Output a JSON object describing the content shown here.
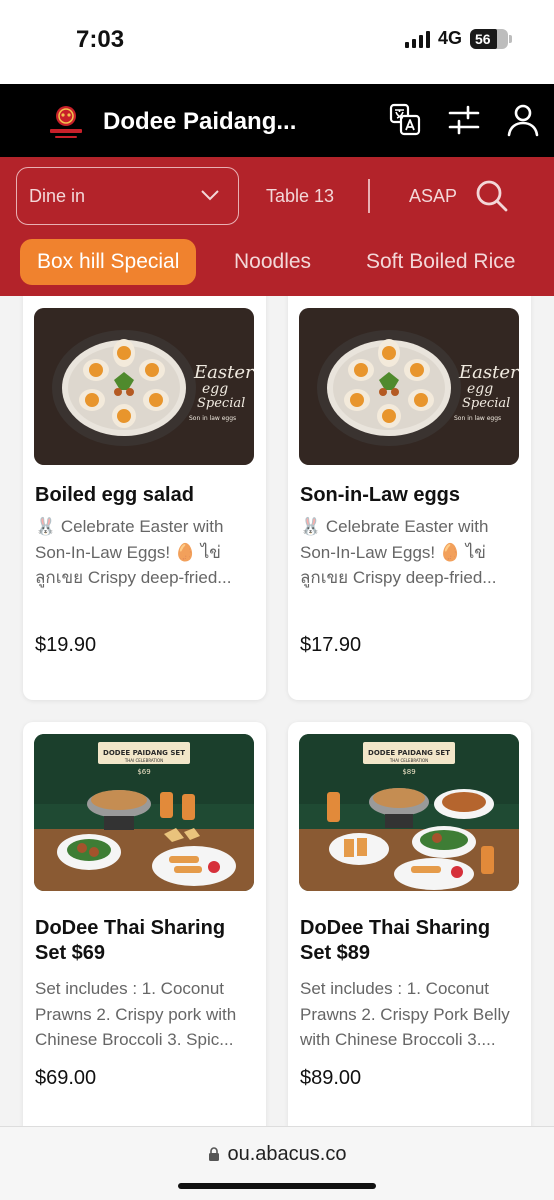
{
  "status_bar": {
    "time": "7:03",
    "network": "4G",
    "battery": "56"
  },
  "header": {
    "title": "Dodee Paidang...",
    "logo_icon": "restaurant-logo",
    "translate_icon": "translate-icon",
    "filter_icon": "sliders-icon",
    "account_icon": "user-icon"
  },
  "filters": {
    "order_type": "Dine in",
    "table": "Table 13",
    "time": "ASAP",
    "search_icon": "search-icon"
  },
  "tabs": [
    {
      "label": "Box hill Special",
      "active": true
    },
    {
      "label": "Noodles",
      "active": false
    },
    {
      "label": "Soft Boiled Rice",
      "active": false
    }
  ],
  "products": [
    {
      "title": "Boiled egg salad",
      "description": "🐰 Celebrate Easter with Son-In-Law Eggs! 🥚 ไข่ลูกเขย  Crispy deep-fried...",
      "price": "$19.90"
    },
    {
      "title": "Son-in-Law eggs",
      "description": "🐰 Celebrate Easter with Son-In-Law Eggs! 🥚 ไข่ลูกเขย  Crispy deep-fried...",
      "price": "$17.90"
    },
    {
      "title": "DoDee Thai Sharing Set $69",
      "description": "Set includes : 1. Coconut Prawns 2. Crispy pork with Chinese Broccoli  3. Spic...",
      "price": "$69.00"
    },
    {
      "title": "DoDee Thai Sharing Set $89",
      "description": "Set includes : 1. Coconut Prawns 2. Crispy Pork Belly with Chinese Broccoli  3....",
      "price": "$89.00"
    }
  ],
  "image_text": {
    "easter": "Easter",
    "egg": "egg",
    "special": "Special",
    "son_in_law": "Son in law eggs",
    "set_banner": "DODEE PAIDANG SET",
    "set_sub": "THAI CELEBRATION",
    "set69_price": "$69",
    "set89_price": "$89"
  },
  "browser": {
    "url": "ou.abacus.co",
    "lock_icon": "lock-icon"
  },
  "colors": {
    "header_bg": "#000000",
    "filter_bg": "#b3232a",
    "active_tab": "#f0822e"
  }
}
